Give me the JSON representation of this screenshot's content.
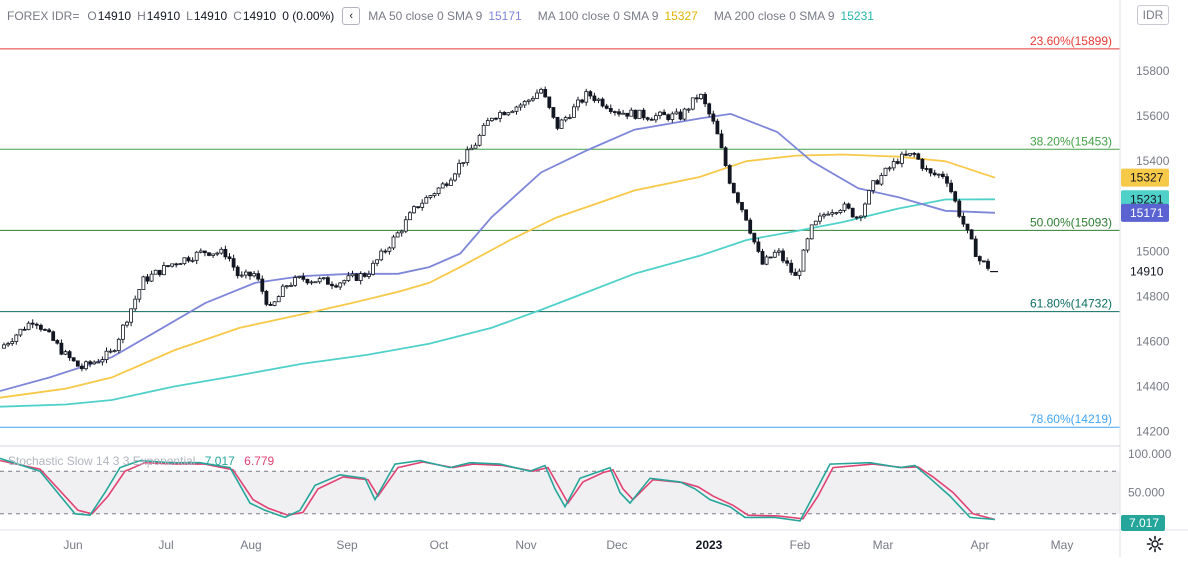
{
  "header": {
    "symbol": "FOREX IDR=",
    "open_label": "O",
    "open": "14910",
    "high_label": "H",
    "high": "14910",
    "low_label": "L",
    "low": "14910",
    "close_label": "C",
    "close": "14910",
    "change": "0 (0.00%)",
    "collapse_icon": "chevron-left-icon",
    "ma50_label": "MA 50 close 0 SMA 9",
    "ma50_value": "15171",
    "ma100_label": "MA 100 close 0 SMA 9",
    "ma100_value": "15327",
    "ma200_label": "MA 200 close 0 SMA 9",
    "ma200_value": "15231"
  },
  "currency_button": "IDR",
  "settings_icon": "gear-icon",
  "colors": {
    "ma50": "#7e86d8",
    "ma100": "#f7c948",
    "ma200": "#4fd1c9",
    "candle": "#131722",
    "stoch_k": "#26a69a",
    "stoch_d": "#e04373",
    "fib_236": "#e53935",
    "fib_382": "#43a047",
    "fib_500": "#2e7d32",
    "fib_618": "#0b6e60",
    "fib_786": "#42a5f5"
  },
  "chart_data": {
    "type": "candlestick",
    "title": "FOREX IDR=",
    "y_ticks": [
      14200,
      14400,
      14600,
      14800,
      15000,
      15200,
      15400,
      15600,
      15800
    ],
    "ylim": [
      14180,
      15965
    ],
    "x_ticks": [
      "Jun",
      "Jul",
      "Aug",
      "Sep",
      "Oct",
      "Nov",
      "Dec",
      "2023",
      "Feb",
      "Mar",
      "Apr",
      "May"
    ],
    "x_tick_bold": "2023",
    "last_price": "14910",
    "fib_levels": [
      {
        "label": "23.60%(15899)",
        "value": 15899,
        "color": "#e53935"
      },
      {
        "label": "38.20%(15453)",
        "value": 15453,
        "color": "#43a047"
      },
      {
        "label": "50.00%(15093)",
        "value": 15093,
        "color": "#2e7d32"
      },
      {
        "label": "61.80%(14732)",
        "value": 14732,
        "color": "#0b6e60"
      },
      {
        "label": "78.60%(14219)",
        "value": 14219,
        "color": "#42a5f5"
      }
    ],
    "price_series": [
      [
        "2022-05-20",
        14570
      ],
      [
        "2022-05-31",
        14700
      ],
      [
        "2022-06-05",
        14620
      ],
      [
        "2022-06-10",
        14540
      ],
      [
        "2022-06-15",
        14480
      ],
      [
        "2022-06-25",
        14550
      ],
      [
        "2022-06-30",
        14710
      ],
      [
        "2022-07-05",
        14870
      ],
      [
        "2022-07-15",
        14950
      ],
      [
        "2022-07-25",
        15000
      ],
      [
        "2022-08-01",
        14990
      ],
      [
        "2022-08-05",
        14880
      ],
      [
        "2022-08-10",
        14900
      ],
      [
        "2022-08-15",
        14740
      ],
      [
        "2022-08-20",
        14850
      ],
      [
        "2022-08-25",
        14880
      ],
      [
        "2022-09-05",
        14860
      ],
      [
        "2022-09-15",
        14900
      ],
      [
        "2022-09-25",
        15080
      ],
      [
        "2022-10-01",
        15200
      ],
      [
        "2022-10-10",
        15300
      ],
      [
        "2022-10-20",
        15480
      ],
      [
        "2022-10-25",
        15600
      ],
      [
        "2022-11-05",
        15660
      ],
      [
        "2022-11-10",
        15720
      ],
      [
        "2022-11-15",
        15550
      ],
      [
        "2022-11-25",
        15700
      ],
      [
        "2022-12-05",
        15620
      ],
      [
        "2022-12-15",
        15600
      ],
      [
        "2022-12-25",
        15600
      ],
      [
        "2022-12-31",
        15700
      ],
      [
        "2023-01-05",
        15550
      ],
      [
        "2023-01-10",
        15300
      ],
      [
        "2023-01-15",
        15150
      ],
      [
        "2023-01-20",
        14940
      ],
      [
        "2023-01-25",
        15000
      ],
      [
        "2023-01-31",
        14880
      ],
      [
        "2023-02-05",
        15100
      ],
      [
        "2023-02-10",
        15180
      ],
      [
        "2023-02-15",
        15200
      ],
      [
        "2023-02-20",
        15150
      ],
      [
        "2023-02-25",
        15300
      ],
      [
        "2023-03-05",
        15410
      ],
      [
        "2023-03-10",
        15430
      ],
      [
        "2023-03-15",
        15340
      ],
      [
        "2023-03-20",
        15340
      ],
      [
        "2023-03-25",
        15150
      ],
      [
        "2023-03-28",
        15050
      ],
      [
        "2023-03-31",
        14960
      ],
      [
        "2023-04-05",
        14910
      ]
    ],
    "ma50": [
      [
        "2022-05-20",
        14380
      ],
      [
        "2022-06-05",
        14440
      ],
      [
        "2022-06-25",
        14530
      ],
      [
        "2022-07-10",
        14650
      ],
      [
        "2022-07-25",
        14770
      ],
      [
        "2022-08-10",
        14860
      ],
      [
        "2022-08-25",
        14890
      ],
      [
        "2022-09-10",
        14900
      ],
      [
        "2022-09-25",
        14900
      ],
      [
        "2022-10-05",
        14930
      ],
      [
        "2022-10-15",
        14990
      ],
      [
        "2022-10-25",
        15150
      ],
      [
        "2022-11-10",
        15350
      ],
      [
        "2022-11-25",
        15450
      ],
      [
        "2022-12-10",
        15540
      ],
      [
        "2022-12-31",
        15590
      ],
      [
        "2023-01-10",
        15610
      ],
      [
        "2023-01-25",
        15530
      ],
      [
        "2023-02-05",
        15400
      ],
      [
        "2023-02-20",
        15280
      ],
      [
        "2023-03-05",
        15240
      ],
      [
        "2023-03-20",
        15180
      ],
      [
        "2023-04-05",
        15171
      ]
    ],
    "ma100": [
      [
        "2022-05-20",
        14350
      ],
      [
        "2022-06-10",
        14390
      ],
      [
        "2022-06-25",
        14440
      ],
      [
        "2022-07-15",
        14560
      ],
      [
        "2022-08-05",
        14660
      ],
      [
        "2022-08-25",
        14720
      ],
      [
        "2022-09-10",
        14770
      ],
      [
        "2022-09-25",
        14820
      ],
      [
        "2022-10-05",
        14860
      ],
      [
        "2022-10-15",
        14930
      ],
      [
        "2022-10-31",
        15050
      ],
      [
        "2022-11-15",
        15150
      ],
      [
        "2022-12-10",
        15270
      ],
      [
        "2022-12-31",
        15330
      ],
      [
        "2023-01-15",
        15400
      ],
      [
        "2023-01-31",
        15425
      ],
      [
        "2023-02-15",
        15430
      ],
      [
        "2023-03-05",
        15420
      ],
      [
        "2023-03-20",
        15400
      ],
      [
        "2023-04-05",
        15327
      ]
    ],
    "ma200": [
      [
        "2022-05-20",
        14310
      ],
      [
        "2022-06-10",
        14320
      ],
      [
        "2022-06-25",
        14340
      ],
      [
        "2022-07-15",
        14400
      ],
      [
        "2022-08-05",
        14450
      ],
      [
        "2022-08-25",
        14500
      ],
      [
        "2022-09-15",
        14540
      ],
      [
        "2022-10-05",
        14590
      ],
      [
        "2022-10-25",
        14660
      ],
      [
        "2022-11-10",
        14740
      ],
      [
        "2022-11-25",
        14820
      ],
      [
        "2022-12-10",
        14900
      ],
      [
        "2022-12-31",
        14980
      ],
      [
        "2023-01-15",
        15050
      ],
      [
        "2023-01-31",
        15090
      ],
      [
        "2023-02-15",
        15130
      ],
      [
        "2023-03-05",
        15190
      ],
      [
        "2023-03-20",
        15230
      ],
      [
        "2023-04-05",
        15231
      ]
    ],
    "stochastic": {
      "label": "Stochastic Slow 14 3 3 Exponential",
      "k_value": "7.017",
      "d_value": "6.779",
      "y_ticks": [
        "100.000",
        "50.000"
      ],
      "band_upper": 80,
      "band_lower": 20,
      "ylim": [
        0,
        100
      ],
      "k": [
        [
          0,
          98
        ],
        [
          40,
          80
        ],
        [
          75,
          20
        ],
        [
          90,
          18
        ],
        [
          105,
          50
        ],
        [
          120,
          85
        ],
        [
          140,
          95
        ],
        [
          170,
          92
        ],
        [
          200,
          92
        ],
        [
          230,
          85
        ],
        [
          250,
          35
        ],
        [
          265,
          25
        ],
        [
          285,
          15
        ],
        [
          300,
          25
        ],
        [
          315,
          60
        ],
        [
          340,
          75
        ],
        [
          365,
          70
        ],
        [
          375,
          40
        ],
        [
          395,
          90
        ],
        [
          420,
          95
        ],
        [
          450,
          85
        ],
        [
          470,
          92
        ],
        [
          500,
          90
        ],
        [
          530,
          80
        ],
        [
          545,
          88
        ],
        [
          555,
          55
        ],
        [
          565,
          30
        ],
        [
          580,
          70
        ],
        [
          600,
          80
        ],
        [
          610,
          85
        ],
        [
          620,
          50
        ],
        [
          630,
          35
        ],
        [
          650,
          70
        ],
        [
          680,
          65
        ],
        [
          695,
          55
        ],
        [
          710,
          40
        ],
        [
          730,
          30
        ],
        [
          745,
          15
        ],
        [
          775,
          15
        ],
        [
          800,
          10
        ],
        [
          815,
          50
        ],
        [
          830,
          90
        ],
        [
          870,
          92
        ],
        [
          900,
          85
        ],
        [
          915,
          88
        ],
        [
          930,
          70
        ],
        [
          950,
          45
        ],
        [
          970,
          15
        ],
        [
          995,
          12
        ]
      ],
      "d": [
        [
          0,
          95
        ],
        [
          40,
          83
        ],
        [
          78,
          25
        ],
        [
          92,
          20
        ],
        [
          108,
          45
        ],
        [
          125,
          80
        ],
        [
          145,
          92
        ],
        [
          175,
          90
        ],
        [
          205,
          90
        ],
        [
          233,
          82
        ],
        [
          253,
          40
        ],
        [
          268,
          28
        ],
        [
          288,
          18
        ],
        [
          303,
          22
        ],
        [
          318,
          55
        ],
        [
          343,
          72
        ],
        [
          368,
          68
        ],
        [
          378,
          45
        ],
        [
          398,
          85
        ],
        [
          423,
          93
        ],
        [
          453,
          85
        ],
        [
          473,
          90
        ],
        [
          503,
          88
        ],
        [
          533,
          80
        ],
        [
          548,
          85
        ],
        [
          558,
          60
        ],
        [
          568,
          35
        ],
        [
          583,
          65
        ],
        [
          603,
          78
        ],
        [
          613,
          82
        ],
        [
          623,
          55
        ],
        [
          633,
          40
        ],
        [
          653,
          68
        ],
        [
          683,
          64
        ],
        [
          698,
          58
        ],
        [
          713,
          45
        ],
        [
          733,
          32
        ],
        [
          748,
          18
        ],
        [
          778,
          17
        ],
        [
          803,
          13
        ],
        [
          818,
          45
        ],
        [
          833,
          85
        ],
        [
          873,
          90
        ],
        [
          903,
          85
        ],
        [
          918,
          86
        ],
        [
          933,
          72
        ],
        [
          953,
          50
        ],
        [
          973,
          20
        ],
        [
          995,
          12
        ]
      ]
    }
  }
}
